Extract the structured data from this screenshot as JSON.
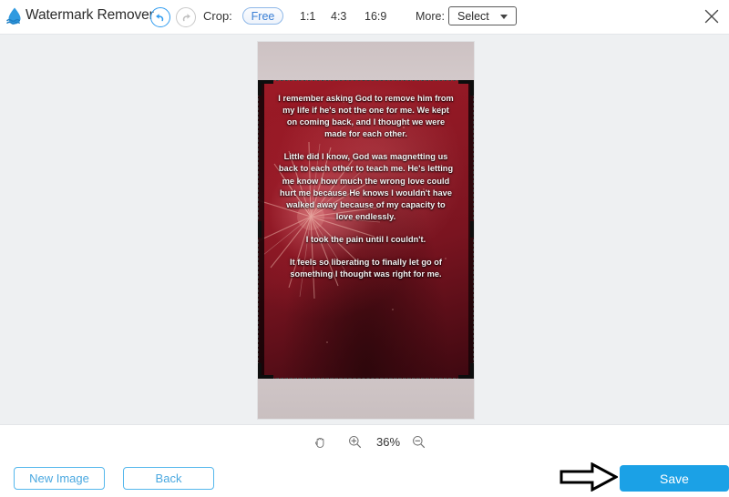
{
  "app": {
    "title": "Watermark Remover",
    "logo_icon": "water-drop-icon",
    "close_icon": "close-icon"
  },
  "toolbar": {
    "undo_icon": "undo-arrow-icon",
    "redo_icon": "redo-arrow-icon",
    "crop_label": "Crop:",
    "ratios": [
      {
        "label": "Free",
        "selected": true
      },
      {
        "label": "1:1",
        "selected": false
      },
      {
        "label": "4:3",
        "selected": false
      },
      {
        "label": "16:9",
        "selected": false
      }
    ],
    "more_label": "More:",
    "select_value": "Select",
    "select_caret_icon": "chevron-down-icon",
    "accent_color": "#3a7fd5"
  },
  "canvas": {
    "photo": {
      "quote_paragraphs": [
        "I remember asking God to remove him from my life if he's not the one for me. We kept on coming back, and I thought we were made for each other.",
        "Little did I know, God was magnetting us back to each other to teach me. He's letting me know how much the wrong love could hurt me because He knows I wouldn't have walked away because of my capacity to love endlessly.",
        "I took the pain until I couldn't.",
        "It feels so liberating to finally let go of something I thought was right for me."
      ]
    }
  },
  "zoom_bar": {
    "hand_icon": "hand-tool-icon",
    "zoom_in_icon": "zoom-in-icon",
    "zoom_level": "36%",
    "zoom_out_icon": "zoom-out-icon"
  },
  "footer": {
    "new_image_label": "New Image",
    "back_label": "Back",
    "save_label": "Save",
    "save_color": "#1ba1e6",
    "annotation_icon": "right-arrow-annotation"
  }
}
